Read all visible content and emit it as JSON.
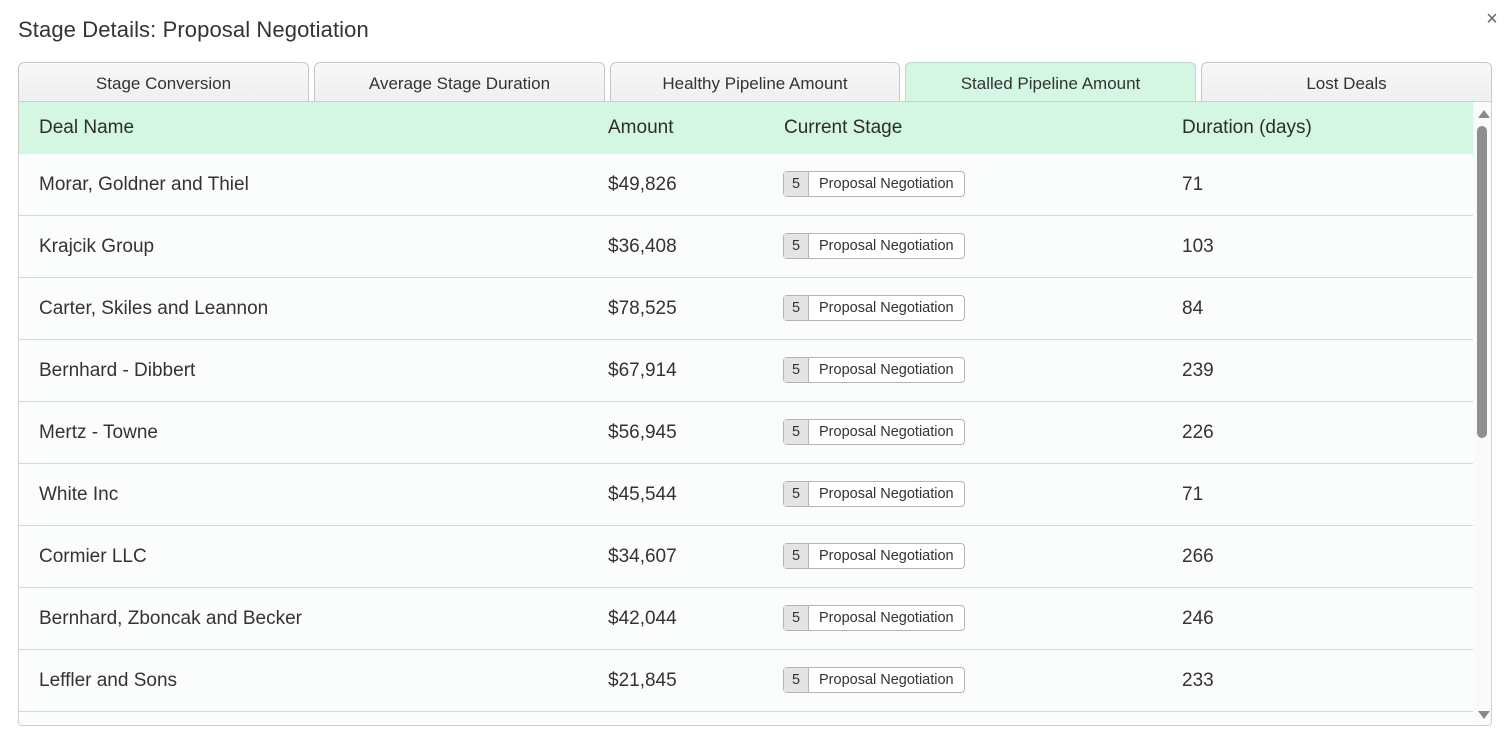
{
  "dialog": {
    "title": "Stage Details: Proposal Negotiation",
    "close_label": "×"
  },
  "tabs": [
    {
      "label": "Stage Conversion",
      "active": false
    },
    {
      "label": "Average Stage Duration",
      "active": false
    },
    {
      "label": "Healthy Pipeline Amount",
      "active": false
    },
    {
      "label": "Stalled Pipeline Amount",
      "active": true
    },
    {
      "label": "Lost Deals",
      "active": false
    }
  ],
  "table": {
    "columns": [
      "Deal Name",
      "Amount",
      "Current Stage",
      "Duration (days)"
    ],
    "rows": [
      {
        "name": "Morar, Goldner and Thiel",
        "amount": "$49,826",
        "stage_num": "5",
        "stage": "Proposal Negotiation",
        "duration": "71"
      },
      {
        "name": "Krajcik Group",
        "amount": "$36,408",
        "stage_num": "5",
        "stage": "Proposal Negotiation",
        "duration": "103"
      },
      {
        "name": "Carter, Skiles and Leannon",
        "amount": "$78,525",
        "stage_num": "5",
        "stage": "Proposal Negotiation",
        "duration": "84"
      },
      {
        "name": "Bernhard - Dibbert",
        "amount": "$67,914",
        "stage_num": "5",
        "stage": "Proposal Negotiation",
        "duration": "239"
      },
      {
        "name": "Mertz - Towne",
        "amount": "$56,945",
        "stage_num": "5",
        "stage": "Proposal Negotiation",
        "duration": "226"
      },
      {
        "name": "White Inc",
        "amount": "$45,544",
        "stage_num": "5",
        "stage": "Proposal Negotiation",
        "duration": "71"
      },
      {
        "name": "Cormier LLC",
        "amount": "$34,607",
        "stage_num": "5",
        "stage": "Proposal Negotiation",
        "duration": "266"
      },
      {
        "name": "Bernhard, Zboncak and Becker",
        "amount": "$42,044",
        "stage_num": "5",
        "stage": "Proposal Negotiation",
        "duration": "246"
      },
      {
        "name": "Leffler and Sons",
        "amount": "$21,845",
        "stage_num": "5",
        "stage": "Proposal Negotiation",
        "duration": "233"
      }
    ]
  },
  "colors": {
    "header_bg": "#d3f7e3",
    "active_tab_bg": "#d3f7e3"
  },
  "icons": {
    "close": "close-icon",
    "scroll_up": "scroll-up-arrow-icon",
    "scroll_down": "scroll-down-arrow-icon"
  }
}
